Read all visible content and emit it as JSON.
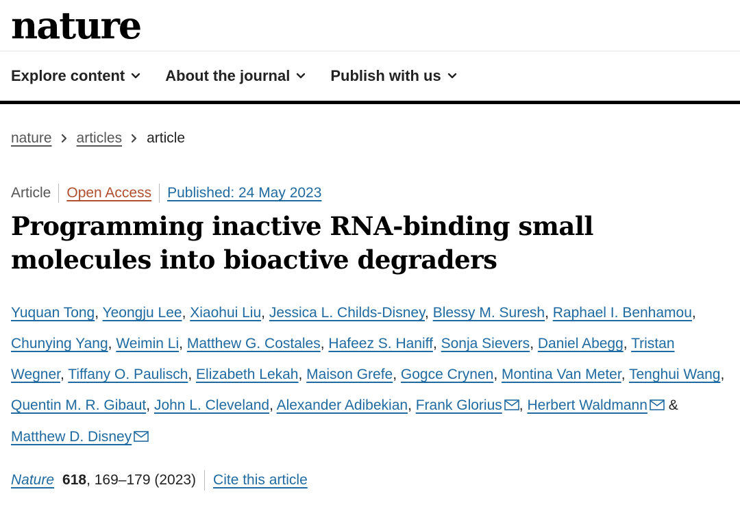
{
  "masthead": {
    "logo_text": "nature"
  },
  "nav": {
    "items": [
      {
        "label": "Explore content",
        "icon": "chevron-down-icon"
      },
      {
        "label": "About the journal",
        "icon": "chevron-down-icon"
      },
      {
        "label": "Publish with us",
        "icon": "chevron-down-icon"
      }
    ]
  },
  "breadcrumb": {
    "items": [
      "nature",
      "articles"
    ],
    "current": "article"
  },
  "article": {
    "type": "Article",
    "access": "Open Access",
    "published": "Published: 24 May 2023",
    "title": "Programming inactive RNA-binding small molecules into bioactive degraders",
    "authors": [
      "Yuquan Tong",
      "Yeongju Lee",
      "Xiaohui Liu",
      "Jessica L. Childs-Disney",
      "Blessy M. Suresh",
      "Raphael I. Benhamou",
      "Chunying Yang",
      "Weimin Li",
      "Matthew G. Costales",
      "Hafeez S. Haniff",
      "Sonja Sievers",
      "Daniel Abegg",
      "Tristan Wegner",
      "Tiffany O. Paulisch",
      "Elizabeth Lekah",
      "Maison Grefe",
      "Gogce Crynen",
      "Montina Van Meter",
      "Tenghui Wang",
      "Quentin M. R. Gibaut",
      "John L. Cleveland",
      "Alexander Adibekian",
      "Frank Glorius",
      "Herbert Waldmann",
      "Matthew D. Disney"
    ],
    "ampersand": "&",
    "separator": ", ",
    "citation": {
      "journal": "Nature",
      "volume": "618",
      "pages": ", 169–179 (2023)",
      "cite_label": "Cite this article"
    }
  }
}
